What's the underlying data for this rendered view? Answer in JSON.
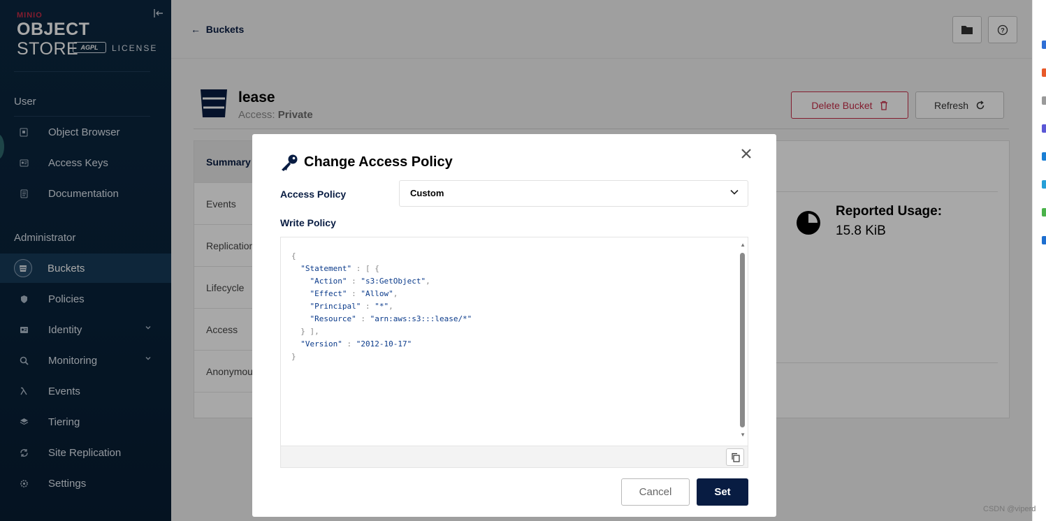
{
  "sidebar": {
    "logo": {
      "brand": "MINIO",
      "product_bold": "OBJECT",
      "product_light": "STORE",
      "license_badge": "AGPL",
      "license": "LICENSE"
    },
    "sections": {
      "user": "User",
      "admin": "Administrator"
    },
    "user_items": [
      {
        "label": "Object Browser",
        "icon": "object-browser-icon"
      },
      {
        "label": "Access Keys",
        "icon": "access-keys-icon"
      },
      {
        "label": "Documentation",
        "icon": "documentation-icon"
      }
    ],
    "admin_items": [
      {
        "label": "Buckets",
        "icon": "bucket-icon",
        "active": true
      },
      {
        "label": "Policies",
        "icon": "shield-icon"
      },
      {
        "label": "Identity",
        "icon": "identity-icon",
        "expandable": true
      },
      {
        "label": "Monitoring",
        "icon": "monitoring-icon",
        "expandable": true
      },
      {
        "label": "Events",
        "icon": "lambda-icon"
      },
      {
        "label": "Tiering",
        "icon": "tiering-icon"
      },
      {
        "label": "Site Replication",
        "icon": "site-replication-icon"
      },
      {
        "label": "Settings",
        "icon": "gear-icon"
      }
    ]
  },
  "header": {
    "back_label": "Buckets"
  },
  "bucket": {
    "name": "lease",
    "access_label": "Access:",
    "access_value": "Private",
    "delete_label": "Delete Bucket",
    "refresh_label": "Refresh"
  },
  "tabs": [
    "Summary",
    "Events",
    "Replication",
    "Lifecycle",
    "Access",
    "Anonymous"
  ],
  "usage": {
    "title": "Reported Usage:",
    "value": "15.8 KiB"
  },
  "modal": {
    "title": "Change Access Policy",
    "access_policy_label": "Access Policy",
    "access_policy_value": "Custom",
    "write_policy_label": "Write Policy",
    "policy_lines": [
      "{",
      "  \"Statement\" : [ {",
      "    \"Action\" : \"s3:GetObject\",",
      "    \"Effect\" : \"Allow\",",
      "    \"Principal\" : \"*\",",
      "    \"Resource\" : \"arn:aws:s3:::lease/*\"",
      "  } ],",
      "  \"Version\" : \"2012-10-17\"",
      "}"
    ],
    "cancel_label": "Cancel",
    "set_label": "Set"
  },
  "watermark": "CSDN @viperd",
  "colors": {
    "sidebar": "#0b2740",
    "accent": "#081c42",
    "danger": "#c72c48"
  }
}
